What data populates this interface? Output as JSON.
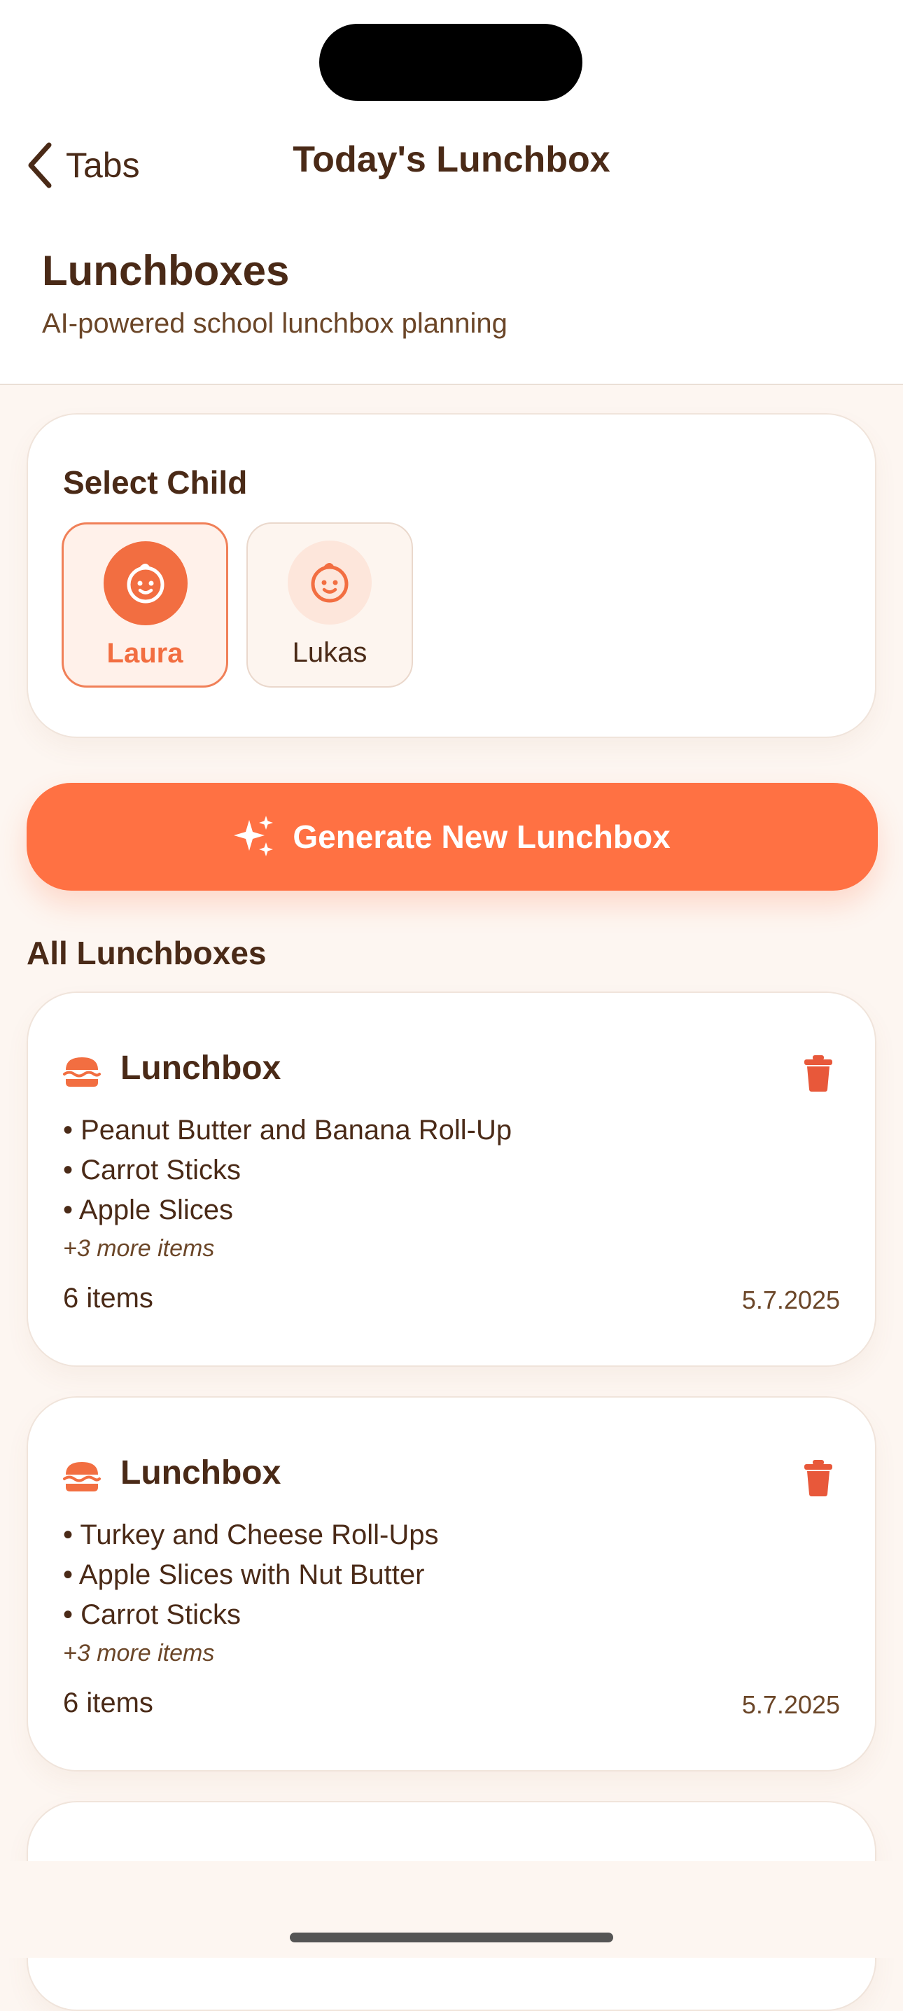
{
  "nav": {
    "back_label": "Tabs",
    "title": "Today's Lunchbox"
  },
  "header": {
    "title": "Lunchboxes",
    "subtitle": "AI-powered school lunchbox planning"
  },
  "child_selector": {
    "label": "Select Child",
    "children": [
      {
        "name": "Laura",
        "selected": true,
        "icon": "baby-face-icon"
      },
      {
        "name": "Lukas",
        "selected": false,
        "icon": "baby-face-icon"
      }
    ]
  },
  "generate_button": {
    "label": "Generate New Lunchbox",
    "icon": "sparkles-icon"
  },
  "lunchbox_list": {
    "heading": "All Lunchboxes",
    "cards": [
      {
        "title": "Lunchbox",
        "icon": "burger-icon",
        "items": [
          "• Peanut Butter and Banana Roll-Up",
          "• Carrot Sticks",
          "• Apple Slices"
        ],
        "more": "+3 more items",
        "count": "6 items",
        "date": "5.7.2025"
      },
      {
        "title": "Lunchbox",
        "icon": "burger-icon",
        "items": [
          "• Turkey and Cheese Roll-Ups",
          "• Apple Slices with Nut Butter",
          "• Carrot Sticks"
        ],
        "more": "+3 more items",
        "count": "6 items",
        "date": "5.7.2025"
      }
    ]
  },
  "colors": {
    "accent": "#ff7143",
    "text": "#4a2a17",
    "background": "#fdf6f1",
    "delete": "#e8583a"
  }
}
